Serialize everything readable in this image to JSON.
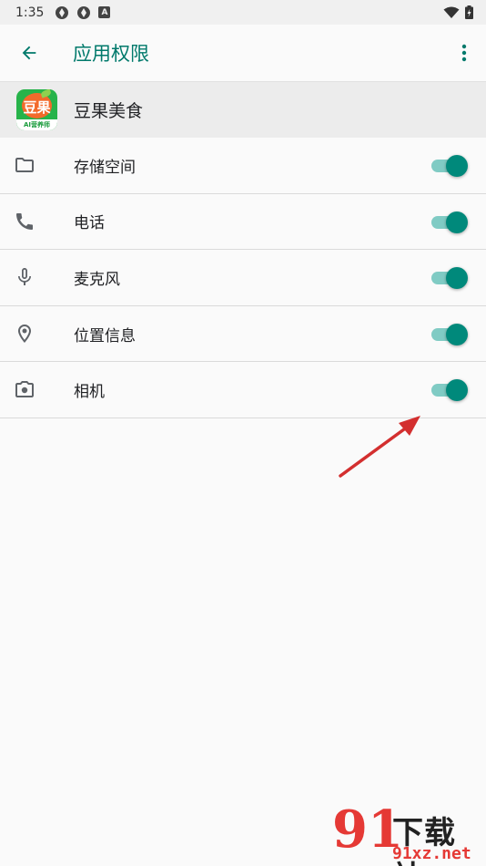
{
  "status_bar": {
    "time": "1:35",
    "notification_letter": "A"
  },
  "app_bar": {
    "title": "应用权限"
  },
  "app": {
    "name": "豆果美食",
    "icon_text": "豆果",
    "icon_subtext": "AI营养师"
  },
  "permissions": [
    {
      "label": "存储空间",
      "icon": "folder-icon",
      "enabled": true
    },
    {
      "label": "电话",
      "icon": "phone-icon",
      "enabled": true
    },
    {
      "label": "麦克风",
      "icon": "microphone-icon",
      "enabled": true
    },
    {
      "label": "位置信息",
      "icon": "location-icon",
      "enabled": true
    },
    {
      "label": "相机",
      "icon": "camera-icon",
      "enabled": true
    }
  ],
  "colors": {
    "accent": "#00796b",
    "toggle_thumb": "#00897b",
    "toggle_track": "#80cbc4",
    "annotation_arrow": "#d32f2f"
  },
  "watermark": {
    "logo": "91",
    "title": "下载站",
    "domain": "91xz.net"
  }
}
